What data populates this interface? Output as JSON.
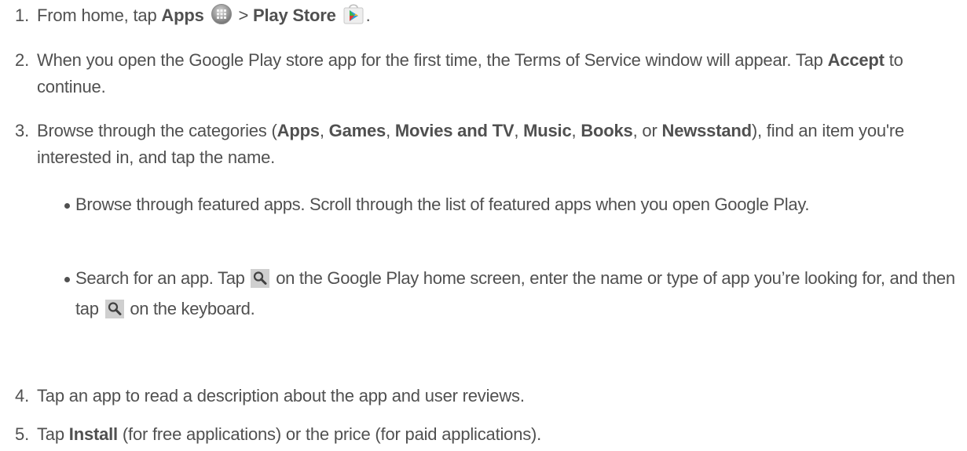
{
  "steps": [
    {
      "number": "1.",
      "prefix": "From home, tap",
      "apps_label": "Apps",
      "apps_icon": "apps-launcher-icon",
      "sep": ">",
      "store_label": "Play Store",
      "store_icon": "play-store-icon",
      "end": "."
    },
    {
      "number": "2.",
      "text_a": "When you open the Google Play store app for the first time, the Terms of Service window will appear. Tap",
      "accept_label": "Accept",
      "text_b": "to continue."
    },
    {
      "number": "3.",
      "text_a": "Browse through the categories (",
      "cat_apps": "Apps",
      "comma1": ", ",
      "cat_games": "Games",
      "comma2": ", ",
      "cat_movies": "Movies and TV",
      "comma3": ", ",
      "cat_music": "Music",
      "comma4": ", ",
      "cat_books": "Books",
      "or": ", or ",
      "cat_newsstand": "Newsstand",
      "text_b": "), find an item you're interested in, and tap the name."
    },
    {
      "number": "4.",
      "text": "Tap an app to read a description about the app and user reviews."
    },
    {
      "number": "5.",
      "text_a": "Tap",
      "install_label": "Install",
      "text_b": "(for free applications) or the price (for paid applications)."
    }
  ],
  "bullets": [
    {
      "text": "Browse through featured apps. Scroll through the list of featured apps when you open Google Play."
    },
    {
      "text_a": "Search for an app. Tap",
      "icon": "search-icon",
      "text_b": "on the Google Play home screen, enter the name or type of app you’re looking for, and then tap",
      "text_c": "on the keyboard."
    }
  ]
}
